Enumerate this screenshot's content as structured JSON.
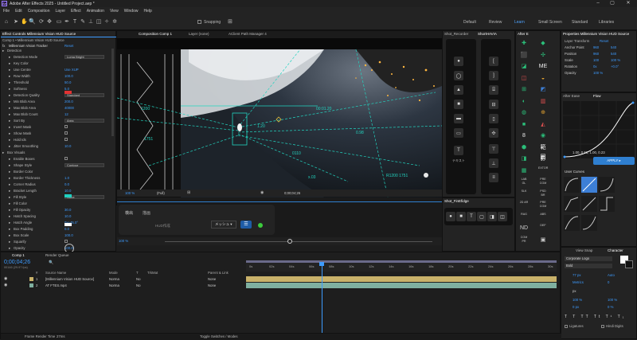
{
  "app": {
    "title": "Adobe After Effects 2025 - Untitled Project.aep *",
    "menu": [
      "File",
      "Edit",
      "Composition",
      "Layer",
      "Effect",
      "Animation",
      "View",
      "Window",
      "Help"
    ],
    "snapping_label": "Snapping",
    "workspaces": [
      "Default",
      "Review",
      "Learn",
      "Small Screen",
      "Standard",
      "Libraries"
    ],
    "active_workspace": "Learn"
  },
  "effect_controls": {
    "tab": "Effect Controls Millennium Vision HUD Source",
    "subtitle": "Comp 1 • Millennium Vision HUD Source",
    "effect_name": "Millennium Vision Tracker",
    "reset": "Reset",
    "properties": [
      {
        "name": "Detection",
        "type": "group"
      },
      {
        "name": "Detection Mode",
        "type": "dropdown",
        "value": "Luma Bright"
      },
      {
        "name": "Key Color",
        "type": "color",
        "value": ""
      },
      {
        "name": "Use Centre",
        "type": "value",
        "value": "Use XUP"
      },
      {
        "name": "Row Width",
        "type": "value",
        "value": "100.0"
      },
      {
        "name": "Threshold",
        "type": "value",
        "value": "50.0"
      },
      {
        "name": "Softness",
        "type": "value",
        "value": "5.0"
      },
      {
        "name": "Detection Quality",
        "type": "dropdown",
        "value": "Standard"
      },
      {
        "name": "Min Blob Area",
        "type": "value",
        "value": "200.0"
      },
      {
        "name": "Max Blob Area",
        "type": "value",
        "value": "40000"
      },
      {
        "name": "Max Blob Count",
        "type": "value",
        "value": "12"
      },
      {
        "name": "Sort By",
        "type": "dropdown",
        "value": "Area"
      },
      {
        "name": "Invert Mask",
        "type": "check",
        "value": ""
      },
      {
        "name": "Show Mask",
        "type": "check",
        "value": ""
      },
      {
        "name": "Hold Ids",
        "type": "check",
        "value": ""
      },
      {
        "name": "Jitter Smoothing",
        "type": "value",
        "value": "10.0"
      },
      {
        "name": "Box Visuals",
        "type": "group"
      },
      {
        "name": "Enable Boxes",
        "type": "check",
        "value": ""
      },
      {
        "name": "Shape Style",
        "type": "dropdown",
        "value": "Contour"
      },
      {
        "name": "Border Color",
        "type": "color",
        "value": ""
      },
      {
        "name": "Border Thickness",
        "type": "value",
        "value": "1.0"
      },
      {
        "name": "Corner Radius",
        "type": "value",
        "value": "0.0"
      },
      {
        "name": "Bracket Length",
        "type": "value",
        "value": "10.0"
      },
      {
        "name": "Fill Style",
        "type": "dropdown",
        "value": "None"
      },
      {
        "name": "Fill Color",
        "type": "color",
        "value": ""
      },
      {
        "name": "Fill Opacity",
        "type": "value",
        "value": "30.0"
      },
      {
        "name": "Hatch Spacing",
        "type": "value",
        "value": "10.0"
      },
      {
        "name": "Hatch Angle",
        "type": "value",
        "value": "0x+45.0°"
      },
      {
        "name": "Box Padding",
        "type": "value",
        "value": "0.0"
      },
      {
        "name": "Box Scale",
        "type": "value",
        "value": "100.0"
      },
      {
        "name": "Squarify",
        "type": "check",
        "value": ""
      },
      {
        "name": "Opacity",
        "type": "value",
        "value": "100.0"
      }
    ]
  },
  "composition": {
    "tabs": [
      "Composition Comp 1",
      "Layer (none)",
      "AClient Path Manager 4"
    ],
    "comp_chip": "Comp 1",
    "zoom": "100 %",
    "resolution": "(Full)",
    "timecode": "0;00;04;26",
    "hud_labels": [
      "1200",
      "1751",
      "0110",
      "00:01.20",
      "R1200 1751",
      "0.98",
      "1.20",
      "x.03",
      "1800"
    ]
  },
  "hud_panel": {
    "tabs": [
      "検出",
      "描画"
    ],
    "placeholder": "HUD作成",
    "mesh_label": "メッシュ"
  },
  "draw_panel": {
    "tabs": [
      "Shot_Recorder",
      "ShortHAVIA"
    ],
    "shape_btns": [
      "●",
      "◯",
      "▲",
      "■",
      "▬",
      "▭"
    ],
    "text_btn": "T",
    "text_label": "テキスト"
  },
  "shot_panel": {
    "tab": "Shot_FinEfidge"
  },
  "effects_panel": {
    "tab": "After E",
    "labels": [
      "ME",
      "8",
      "範囲",
      "影",
      "EXTOR",
      "LAB GL",
      "PRE CGM",
      "SLK",
      "PSD BR",
      "2D AR",
      "PRE CGM",
      "RAG",
      "ABS",
      "ND",
      "DEF",
      "COM PR"
    ]
  },
  "properties_panel": {
    "tab": "Properties Millennium Vision HUD Source",
    "section": "Layer Transform",
    "reset": "Reset",
    "rows": [
      {
        "label": "Anchor Point",
        "v1": "960",
        "v2": "540"
      },
      {
        "label": "Position",
        "v1": "960",
        "v2": "540"
      },
      {
        "label": "Scale",
        "v1": "100",
        "v2": "100 %"
      },
      {
        "label": "Rotation",
        "v1": "0x",
        "v2": "+0.0°"
      },
      {
        "label": "Opacity",
        "v1": "100 %",
        "v2": ""
      }
    ]
  },
  "flow_panel": {
    "tabs": [
      "After Ease",
      "Flow"
    ],
    "values": "1.00, 0.61, 1.00, 0.23",
    "apply": "APPLY ▸",
    "user_curves": "User Curves"
  },
  "view_snap": {
    "tab": "View Snap"
  },
  "character": {
    "tab": "Character",
    "font": "Corporate Logo",
    "style": "Bold",
    "size": "77 px",
    "leading": "Auto",
    "kerning": "Metrics",
    "tracking": "0",
    "unit": "px",
    "scale_v": "100 %",
    "scale_h": "100 %",
    "baseline": "0 px",
    "tsume": "0 %",
    "ligatures": "Ligatures",
    "hindi": "Hindi Digits"
  },
  "timeline": {
    "tabs": [
      "Comp 1",
      "Render Queue"
    ],
    "timecode": "0;00;04;26",
    "fps": "00146 (29.97 fps)",
    "columns": [
      "#",
      "Source Name",
      "Mode",
      "T",
      "TrkMat",
      "Parent & Link"
    ],
    "layers": [
      {
        "num": "1",
        "name": "[Millennium Vision HUD Source]",
        "mode": "Norma",
        "trk": "No",
        "parent": "None",
        "color": "#c9b26a"
      },
      {
        "num": "2",
        "name": "AT FTES.mp4",
        "mode": "Norma",
        "trk": "No",
        "parent": "None",
        "color": "#7fb0a0"
      }
    ],
    "ruler": [
      "0s",
      "02s",
      "04s",
      "06s",
      "08s",
      "10s",
      "12s",
      "14s",
      "16s",
      "18s",
      "20s",
      "22s",
      "24s",
      "26s",
      "28s",
      "30s"
    ],
    "footer": "Frame Render Time",
    "footer_val": "27ms",
    "footer_right": "Toggle Switches / Modes"
  }
}
